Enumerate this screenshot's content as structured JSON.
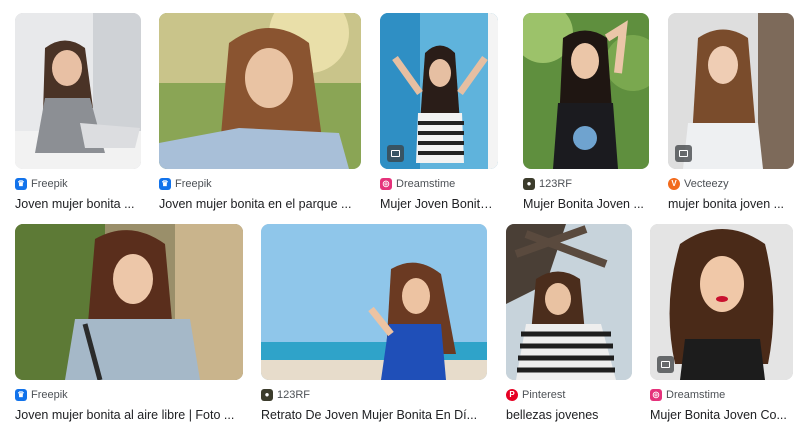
{
  "results": [
    {
      "source": "Freepik",
      "favicon_icon": "freepik-icon",
      "favicon_color": "#1273eb",
      "title": "Joven mujer bonita ..."
    },
    {
      "source": "Freepik",
      "favicon_icon": "freepik-icon",
      "favicon_color": "#1273eb",
      "title": "Joven mujer bonita en el parque ..."
    },
    {
      "source": "Dreamstime",
      "favicon_icon": "dreamstime-icon",
      "favicon_color": "#e5327b",
      "title": "Mujer Joven Bonita ..."
    },
    {
      "source": "123RF",
      "favicon_icon": "123rf-icon",
      "favicon_color": "#3c3c2c",
      "title": "Mujer Bonita Joven ..."
    },
    {
      "source": "Vecteezy",
      "favicon_icon": "vecteezy-icon",
      "favicon_color": "#f26b1d",
      "title": "mujer bonita joven ..."
    },
    {
      "source": "Freepik",
      "favicon_icon": "freepik-icon",
      "favicon_color": "#1273eb",
      "title": "Joven mujer bonita al aire libre | Foto ..."
    },
    {
      "source": "123RF",
      "favicon_icon": "123rf-icon",
      "favicon_color": "#3c3c2c",
      "title": "Retrato De Joven Mujer Bonita En Dí..."
    },
    {
      "source": "Pinterest",
      "favicon_icon": "pinterest-icon",
      "favicon_color": "#e60023",
      "title": "bellezas jovenes"
    },
    {
      "source": "Dreamstime",
      "favicon_icon": "dreamstime-icon",
      "favicon_color": "#e5327b",
      "title": "Mujer Bonita Joven Co..."
    }
  ]
}
